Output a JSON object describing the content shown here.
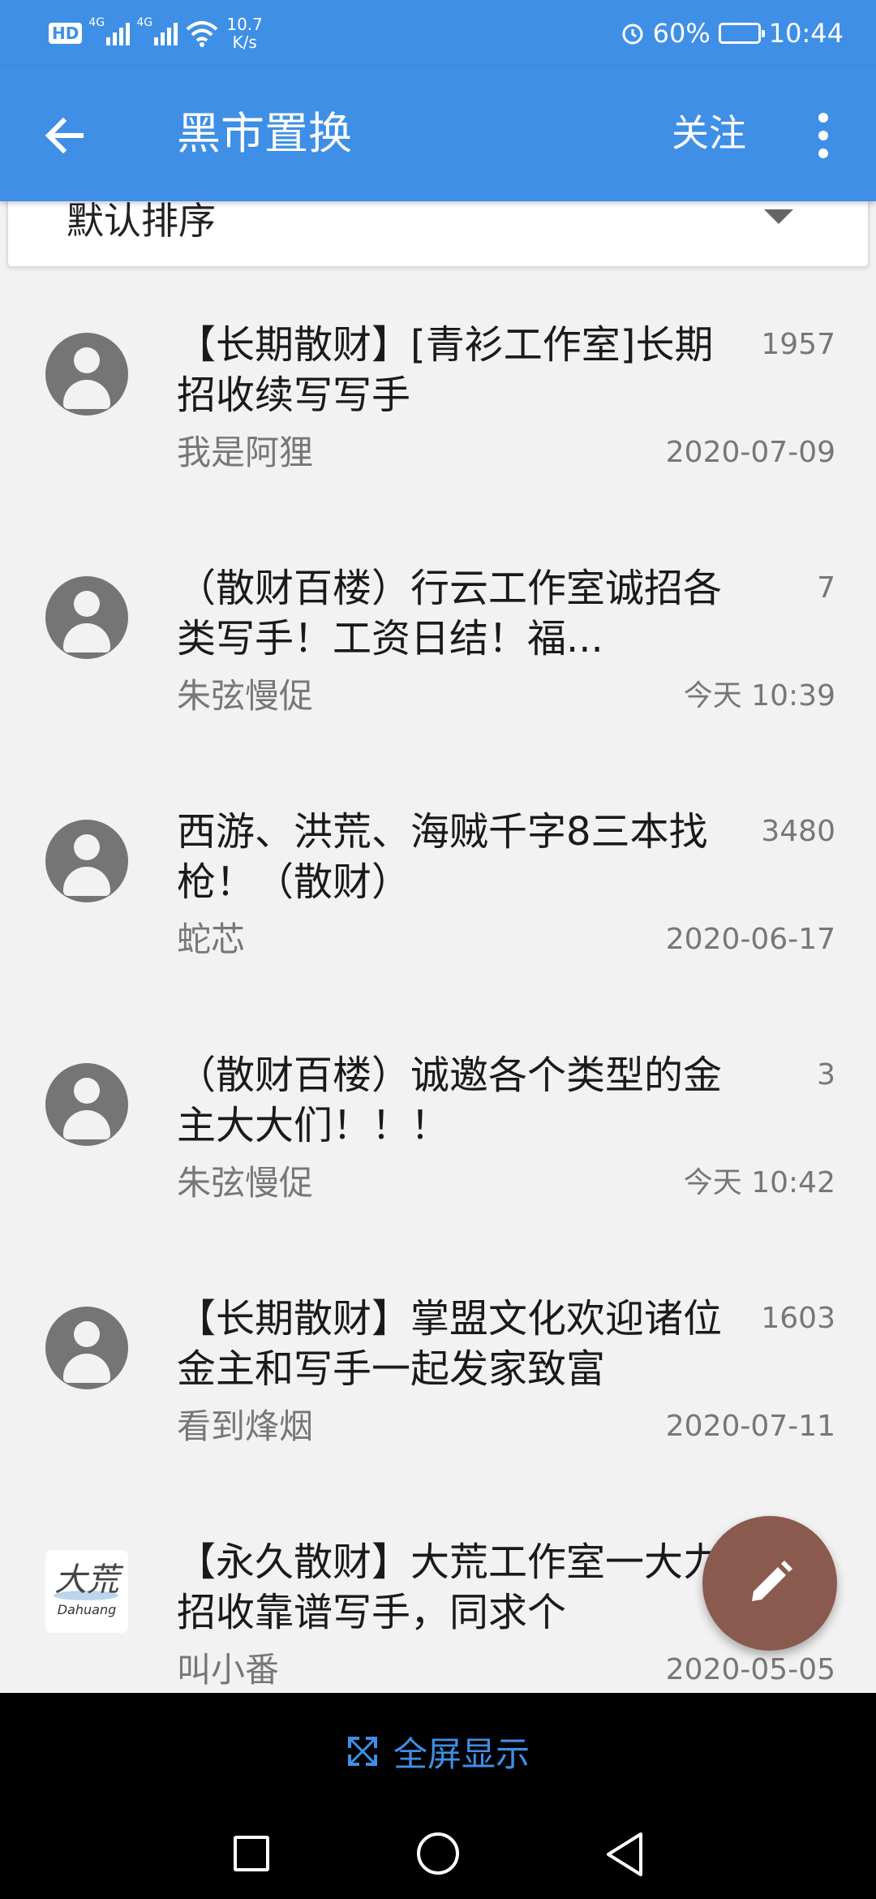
{
  "status_bar": {
    "hd": "HD",
    "signal_1": "4G",
    "signal_2": "4G",
    "speed_value": "10.7",
    "speed_unit": "K/s",
    "battery": "60%",
    "battery_fraction": 0.6,
    "time": "10:44"
  },
  "app_bar": {
    "title": "黑市置换",
    "follow_label": "关注"
  },
  "sort": {
    "label": "默认排序"
  },
  "threads": [
    {
      "title": "【长期散财】[青衫工作室]长期招收续写写手",
      "count": "1957",
      "author": "我是阿狸",
      "date": "2020-07-09",
      "avatar": "person-icon"
    },
    {
      "title": "（散财百楼）行云工作室诚招各类写手！工资日结！福...",
      "count": "7",
      "author": "朱弦慢促",
      "date": "今天 10:39",
      "avatar": "person-icon"
    },
    {
      "title": "西游、洪荒、海贼千字8三本找枪！（散财）",
      "count": "3480",
      "author": "蛇芯",
      "date": "2020-06-17",
      "avatar": "person-icon"
    },
    {
      "title": "（散财百楼）诚邀各个类型的金主大大们！！！",
      "count": "3",
      "author": "朱弦慢促",
      "date": "今天 10:42",
      "avatar": "person-icon"
    },
    {
      "title": "【长期散财】掌盟文化欢迎诸位金主和写手一起发家致富",
      "count": "1603",
      "author": "看到烽烟",
      "date": "2020-07-11",
      "avatar": "person-icon"
    },
    {
      "title": "【永久散财】大荒工作室一大力招收靠谱写手，同求个",
      "count": "",
      "author": "叫小番",
      "date": "2020-05-05",
      "avatar": "studio-logo",
      "logo_text": "大荒",
      "logo_sub": "Dahuang"
    }
  ],
  "fullscreen": {
    "label": "全屏显示"
  },
  "colors": {
    "primary": "#3f8fe6",
    "fab": "#8a5a4e",
    "background": "#f2f2f2"
  }
}
